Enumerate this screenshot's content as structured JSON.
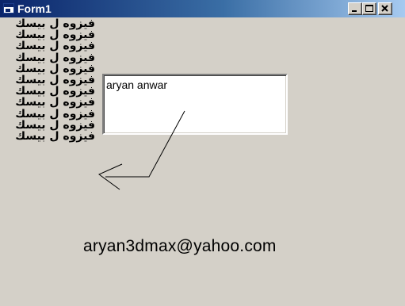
{
  "window": {
    "title": "Form1",
    "icon": "form-icon",
    "controls": [
      "minimize",
      "maximize",
      "close"
    ]
  },
  "labels": [
    "فيزوه ل بيسك",
    "فيزوه ل بيسك",
    "فيزوه ل بيسك",
    "فيزوه ل بيسك",
    "فيزوه ل بيسك",
    "فيزوه ل بيسك",
    "فيزوه ل بيسك",
    "فيزوه ل بيسك",
    "فيزوه ل بيسك",
    "فيزوه ل بيسك",
    "فيزوه ل بيسك"
  ],
  "textbox": {
    "value": "aryan anwar"
  },
  "email": "aryan3dmax@yahoo.com",
  "colors": {
    "face": "#d4d0c8",
    "title_start": "#0a246a",
    "title_end": "#a6caf0"
  }
}
